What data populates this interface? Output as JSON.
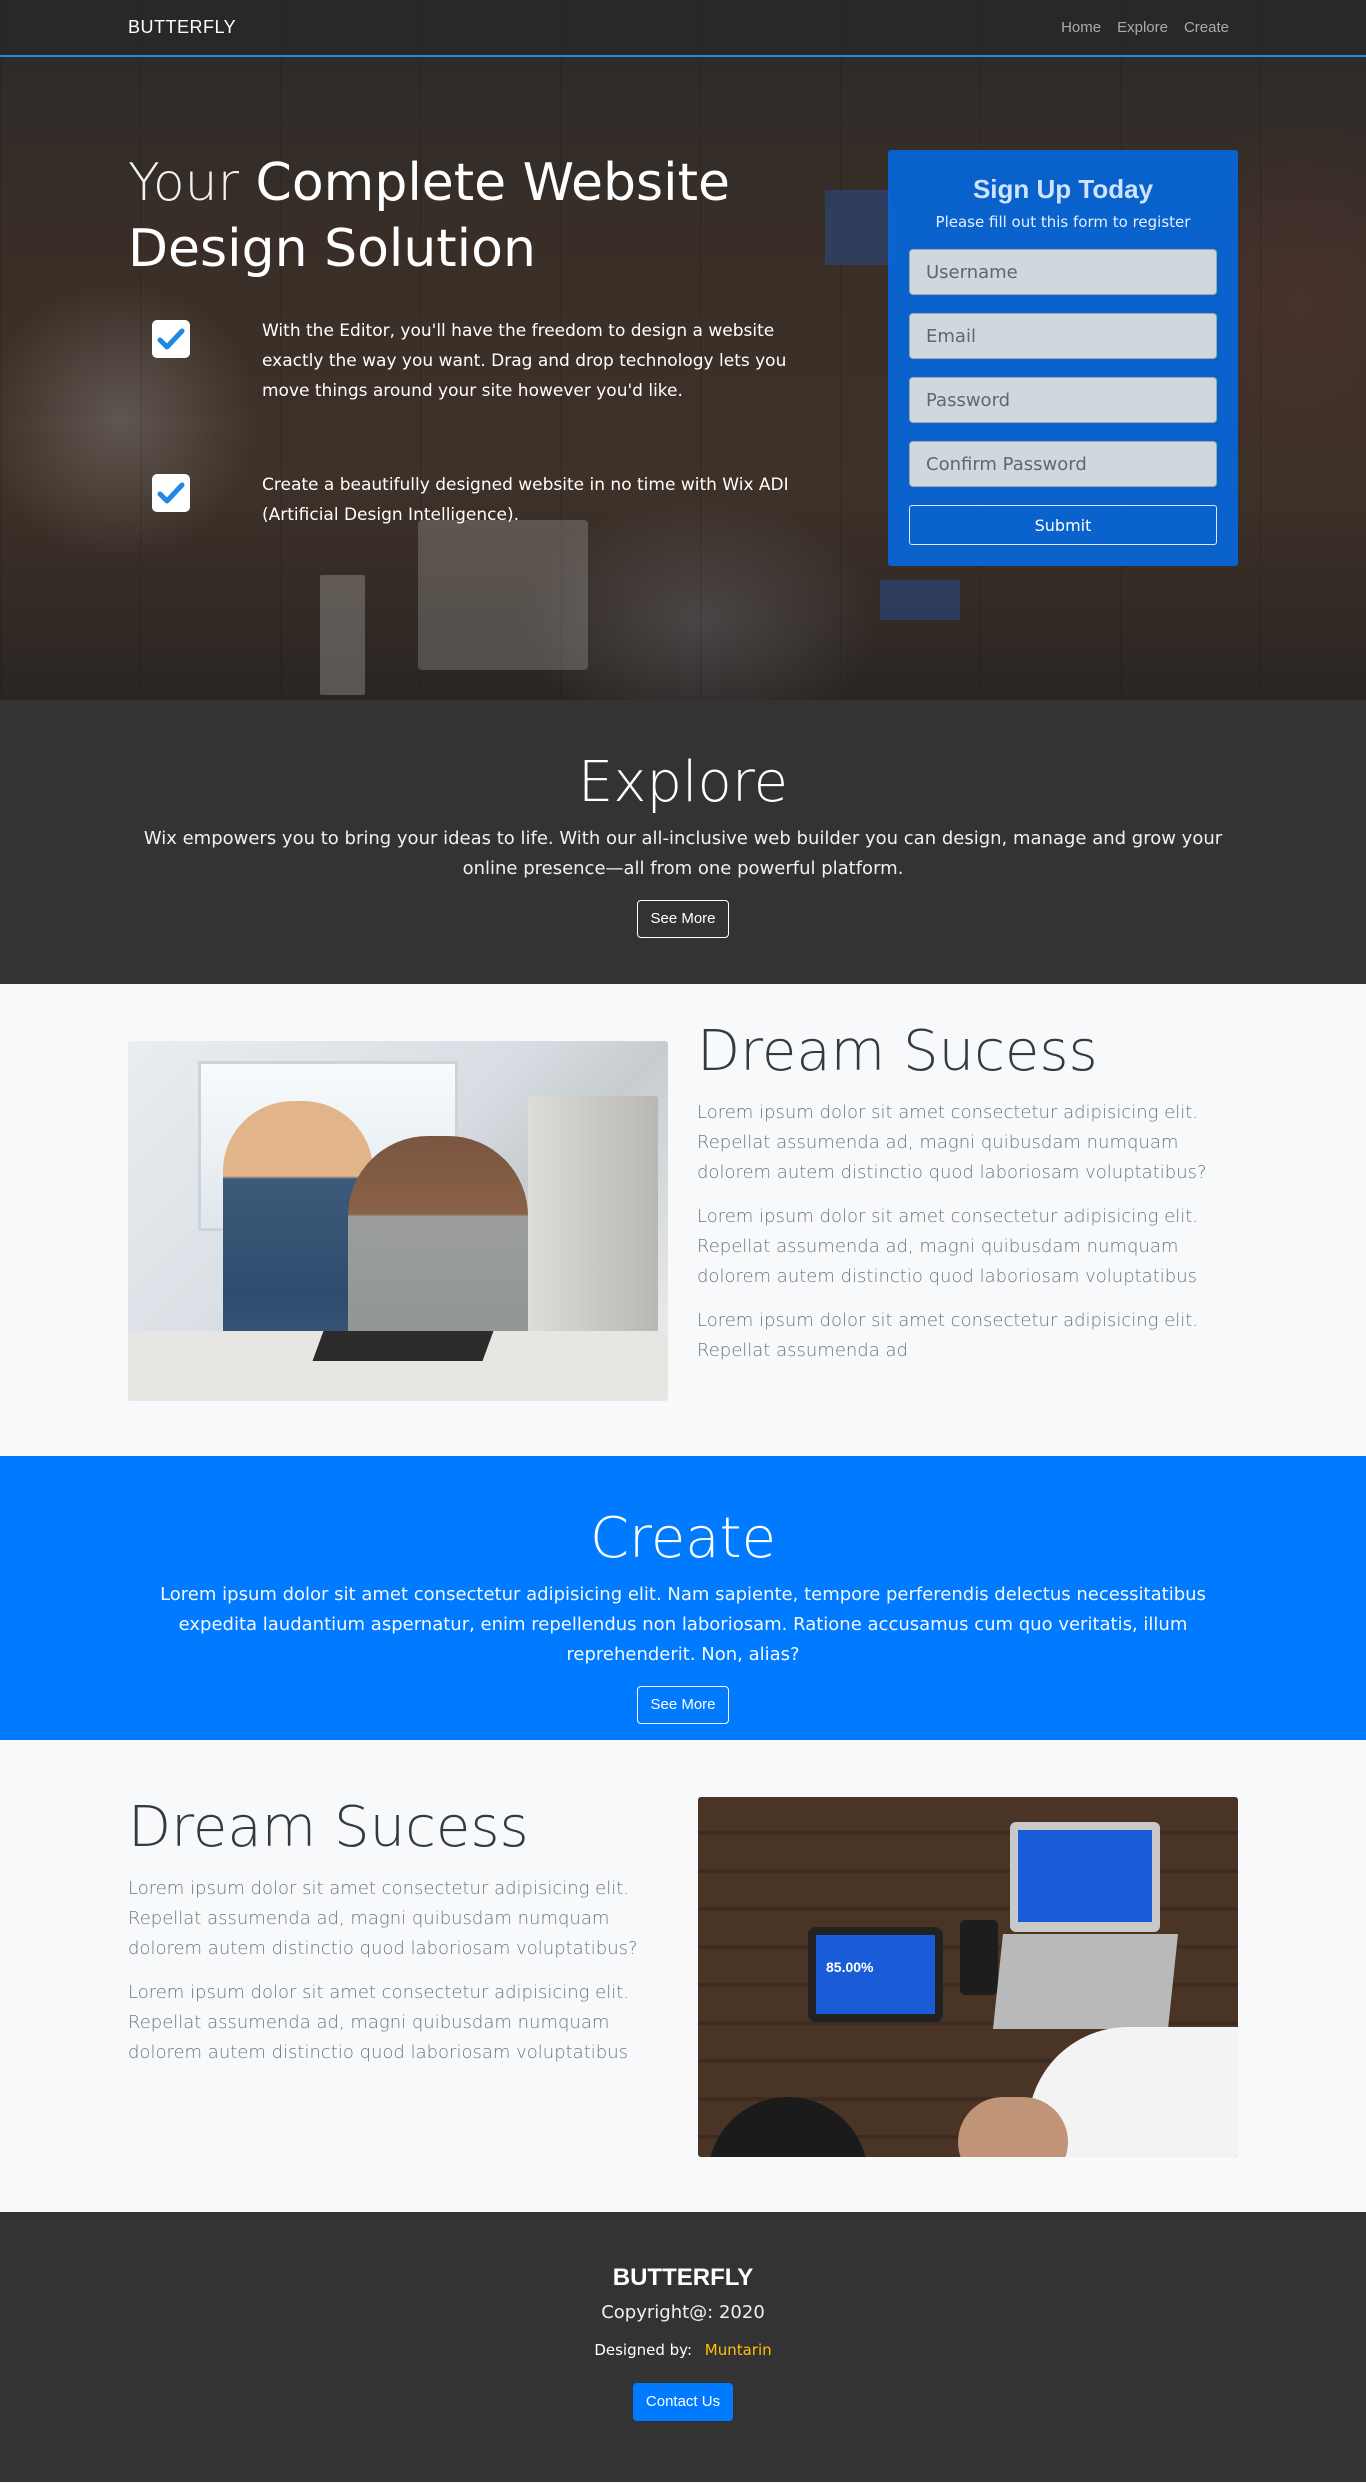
{
  "nav": {
    "brand": "BUTTERFLY",
    "links": [
      "Home",
      "Explore",
      "Create"
    ]
  },
  "hero": {
    "title_light": "Your",
    "title_bold_1": "Complete Website",
    "title_bold_2": "Design Solution",
    "features": [
      "With the Editor, you'll have the freedom to design a website exactly the way you want. Drag and drop technology lets you move things around your site however you'd like.",
      "Create a beautifully designed website in no time with Wix ADI (Artificial Design Intelligence)."
    ]
  },
  "signup": {
    "title": "Sign Up Today",
    "subtitle": "Please fill out this form to register",
    "username_placeholder": "Username",
    "email_placeholder": "Email",
    "password_placeholder": "Password",
    "confirm_placeholder": "Confirm Password",
    "submit_label": "Submit"
  },
  "explore": {
    "title": "Explore",
    "text": "Wix empowers you to bring your ideas to life. With our all-inclusive web builder you can design, manage and grow your online presence—all from one powerful platform.",
    "button": "See More"
  },
  "dream1": {
    "title": "Dream Sucess",
    "paragraphs": [
      "Lorem ipsum dolor sit amet consectetur adipisicing elit. Repellat assumenda ad, magni quibusdam numquam dolorem autem distinctio quod laboriosam voluptatibus?",
      "Lorem ipsum dolor sit amet consectetur adipisicing elit. Repellat assumenda ad, magni quibusdam numquam dolorem autem distinctio quod laboriosam voluptatibus",
      "Lorem ipsum dolor sit amet consectetur adipisicing elit. Repellat assumenda ad"
    ]
  },
  "create": {
    "title": "Create",
    "text": "Lorem ipsum dolor sit amet consectetur adipisicing elit. Nam sapiente, tempore perferendis delectus necessitatibus expedita laudantium aspernatur, enim repellendus non laboriosam. Ratione accusamus cum quo veritatis, illum reprehenderit. Non, alias?",
    "button": "See More"
  },
  "dream2": {
    "title": "Dream Sucess",
    "paragraphs": [
      "Lorem ipsum dolor sit amet consectetur adipisicing elit. Repellat assumenda ad, magni quibusdam numquam dolorem autem distinctio quod laboriosam voluptatibus?",
      "Lorem ipsum dolor sit amet consectetur adipisicing elit. Repellat assumenda ad, magni quibusdam numquam dolorem autem distinctio quod laboriosam voluptatibus"
    ],
    "tablet_text": "85.00%"
  },
  "footer": {
    "brand": "BUTTERFLY",
    "copyright": "Copyright@: 2020",
    "designed_label": "Designed by:",
    "designed_author": "Muntarin",
    "contact": "Contact Us"
  },
  "colors": {
    "primary": "#007bff",
    "dark": "#333333",
    "accent": "#ffc107"
  },
  "icons": [
    "check-icon"
  ]
}
